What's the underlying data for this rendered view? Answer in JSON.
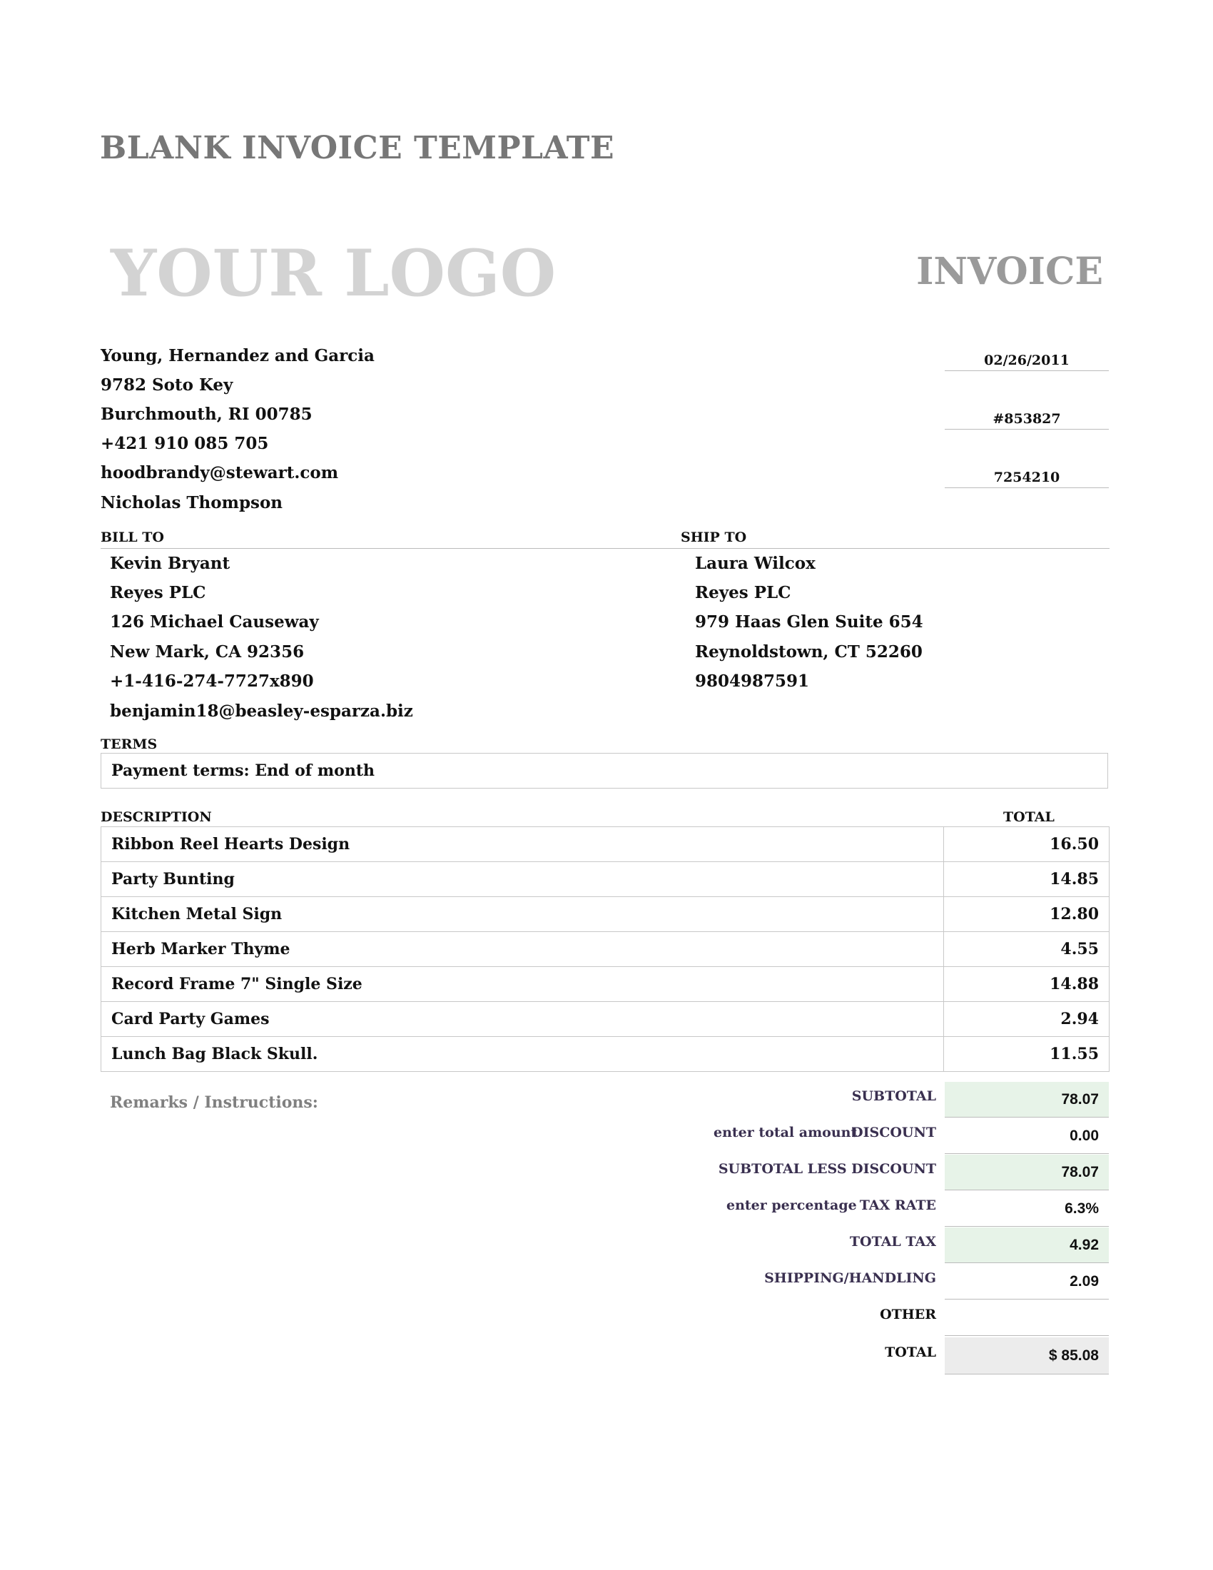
{
  "header": {
    "page_title": "BLANK INVOICE TEMPLATE",
    "logo_text": "YOUR LOGO",
    "invoice_word": "INVOICE"
  },
  "sender": {
    "company": "Young, Hernandez and Garcia",
    "street": "9782 Soto Key",
    "city": "Burchmouth, RI 00785",
    "phone": "+421 910 085 705",
    "email": "hoodbrandy@stewart.com",
    "contact": "Nicholas Thompson"
  },
  "meta": {
    "date": "02/26/2011",
    "invoice_number": "#853827",
    "customer_id": "7254210"
  },
  "bill_to": {
    "label": "BILL TO",
    "name": "Kevin Bryant",
    "company": "Reyes PLC",
    "street": "126 Michael Causeway",
    "city": "New Mark, CA 92356",
    "phone": "+1-416-274-7727x890",
    "email": "benjamin18@beasley-esparza.biz"
  },
  "ship_to": {
    "label": "SHIP TO",
    "name": "Laura Wilcox",
    "company": "Reyes PLC",
    "street": "979 Haas Glen Suite 654",
    "city": "Reynoldstown, CT 52260",
    "phone": "9804987591"
  },
  "terms": {
    "label": "TERMS",
    "text": "Payment terms: End of month"
  },
  "items": {
    "description_header": "DESCRIPTION",
    "total_header": "TOTAL",
    "rows": [
      {
        "description": "Ribbon Reel Hearts Design",
        "total": "16.50"
      },
      {
        "description": "Party Bunting",
        "total": "14.85"
      },
      {
        "description": "Kitchen Metal Sign",
        "total": "12.80"
      },
      {
        "description": "Herb Marker Thyme",
        "total": "4.55"
      },
      {
        "description": "Record Frame 7\" Single Size",
        "total": "14.88"
      },
      {
        "description": "Card Party Games",
        "total": "2.94"
      },
      {
        "description": "Lunch Bag Black Skull.",
        "total": "11.55"
      }
    ]
  },
  "remarks_label": "Remarks / Instructions:",
  "summary": {
    "subtotal_label": "SUBTOTAL",
    "subtotal": "78.07",
    "discount_note": "enter total amount",
    "discount_label": "DISCOUNT",
    "discount": "0.00",
    "subtotal_less_discount_label": "SUBTOTAL LESS DISCOUNT",
    "subtotal_less_discount": "78.07",
    "tax_rate_note": "enter percentage",
    "tax_rate_label": "TAX RATE",
    "tax_rate": "6.3%",
    "total_tax_label": "TOTAL TAX",
    "total_tax": "4.92",
    "shipping_label": "SHIPPING/HANDLING",
    "shipping": "2.09",
    "other_label": "OTHER",
    "other": "",
    "total_label": "TOTAL",
    "total": "$ 85.08"
  },
  "colors": {
    "highlight_green": "#e7f3e8",
    "total_grey": "#ececec",
    "label_purple": "#3a3050"
  }
}
